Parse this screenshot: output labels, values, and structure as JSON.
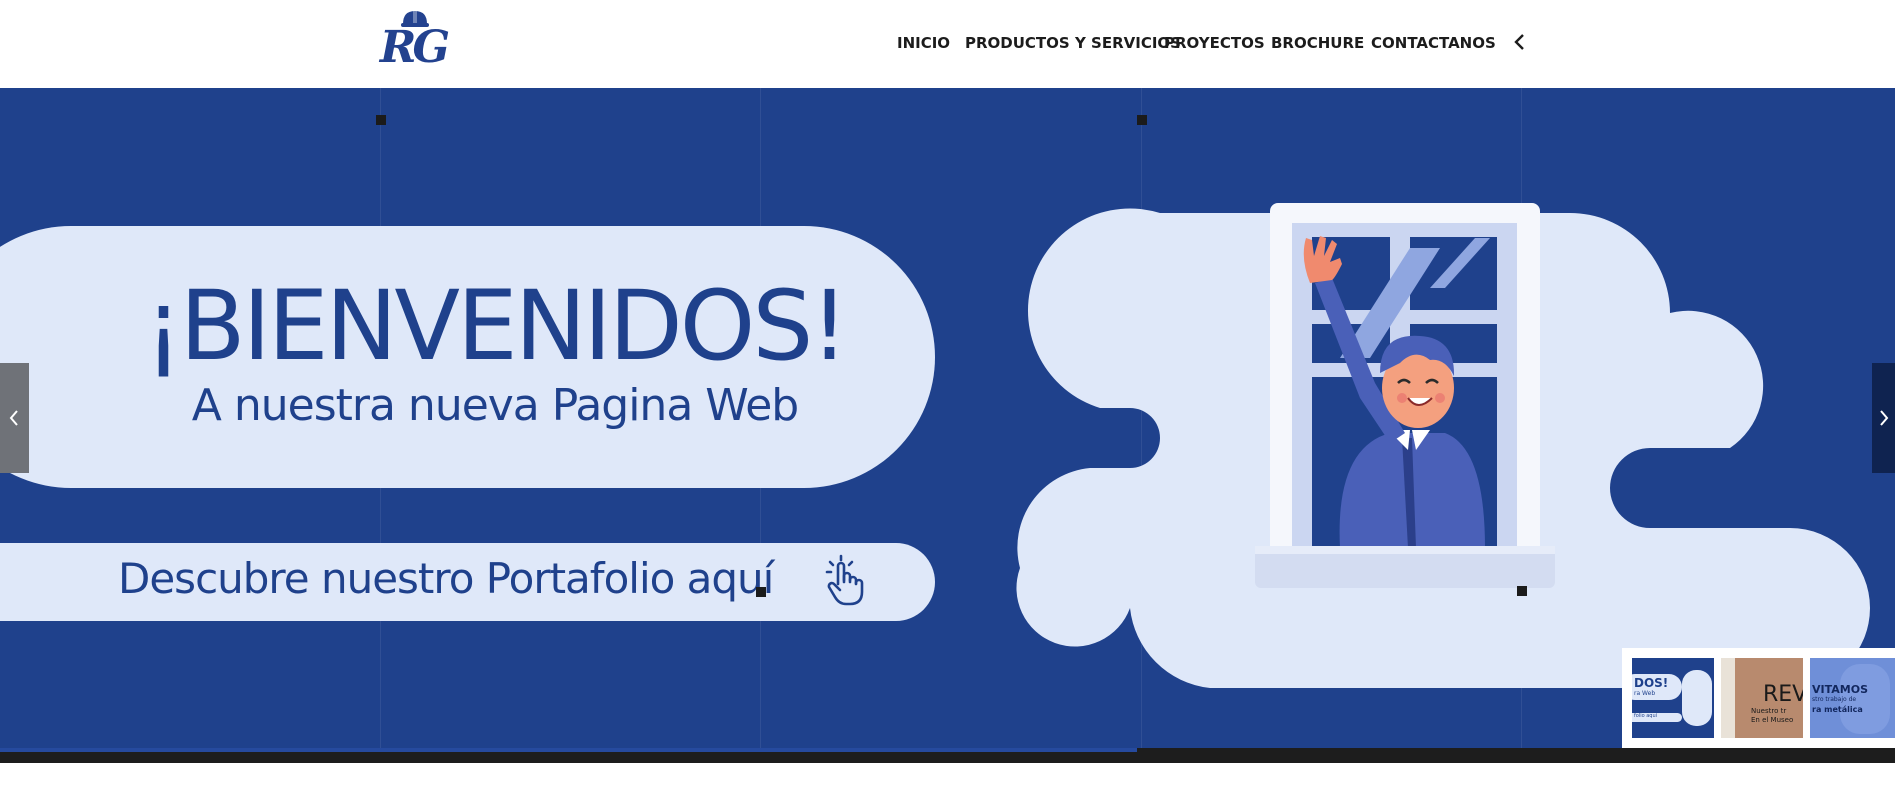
{
  "header": {
    "logo_text": "RG",
    "nav": [
      {
        "label": "INICIO"
      },
      {
        "label": "PRODUCTOS Y SERVICIOS"
      },
      {
        "label": "PROYECTOS"
      },
      {
        "label": "BROCHURE"
      },
      {
        "label": "CONTACTANOS"
      }
    ],
    "menu_toggle_icon": "chevron-left-icon"
  },
  "slide": {
    "headline": "¡BIENVENIDOS!",
    "subheadline": "A nuestra nueva Pagina Web",
    "cta": "Descubre nuestro Portafolio aquí",
    "cta_icon": "pointer-hand-icon",
    "illustration": "man-waving-window-icon"
  },
  "slider": {
    "prev_icon": "chevron-left-icon",
    "next_icon": "chevron-right-icon",
    "progress": 0.6,
    "thumbnails": [
      {
        "lines": [
          "DOS!",
          "ra Web",
          "folio aquí"
        ]
      },
      {
        "lines": [
          "REV",
          "Nuestro tr",
          "En el Museo"
        ]
      },
      {
        "lines": [
          "VITAMOS",
          "stro trabajo de",
          "ra metálica"
        ]
      }
    ]
  },
  "colors": {
    "brand_blue": "#1f418c",
    "light_panel": "#dfe8f9",
    "nav_text": "#1c1c1c"
  }
}
